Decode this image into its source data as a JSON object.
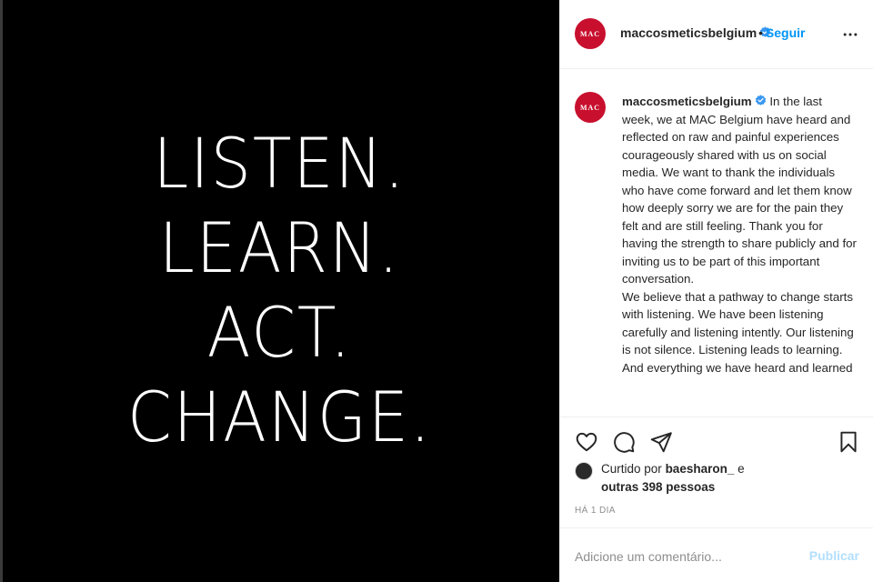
{
  "post": {
    "image_lines": [
      "LISTEN.",
      "LEARN.",
      "ACT.",
      "CHANGE."
    ]
  },
  "header": {
    "avatar_logo": "MAC",
    "username": "maccosmeticsbelgium",
    "separator": "•",
    "follow_label": "Seguir",
    "more_icon": "more-horizontal-icon"
  },
  "caption": {
    "avatar_logo": "MAC",
    "username": "maccosmeticsbelgium",
    "paragraphs": [
      "In the last week, we at MAC Belgium have heard and reflected on raw and painful experiences courageously shared with us on social media. We want to thank the individuals who have come forward and let them know how deeply sorry we are for the pain they felt and are still feeling. Thank you for having the strength to share publicly and for inviting us to be part of this important conversation.",
      "We believe that a pathway to change starts with listening. We have been listening carefully and listening intently. Our listening is not silence. Listening leads to learning. And everything we have heard and learned"
    ]
  },
  "actions": {
    "like_icon": "heart-icon",
    "comment_icon": "comment-icon",
    "share_icon": "send-icon",
    "save_icon": "bookmark-icon"
  },
  "likes": {
    "prefix": "Curtido por",
    "user": "baesharon_",
    "conj": "e",
    "others": "outras 398 pessoas"
  },
  "timestamp": "HÁ 1 DIA",
  "comment": {
    "placeholder": "Adicione um comentário...",
    "publish_label": "Publicar"
  },
  "colors": {
    "brand_red": "#c8102e",
    "link_blue": "#0095f6",
    "publish_disabled": "#b2dffc",
    "verified_blue": "#3897f0"
  }
}
